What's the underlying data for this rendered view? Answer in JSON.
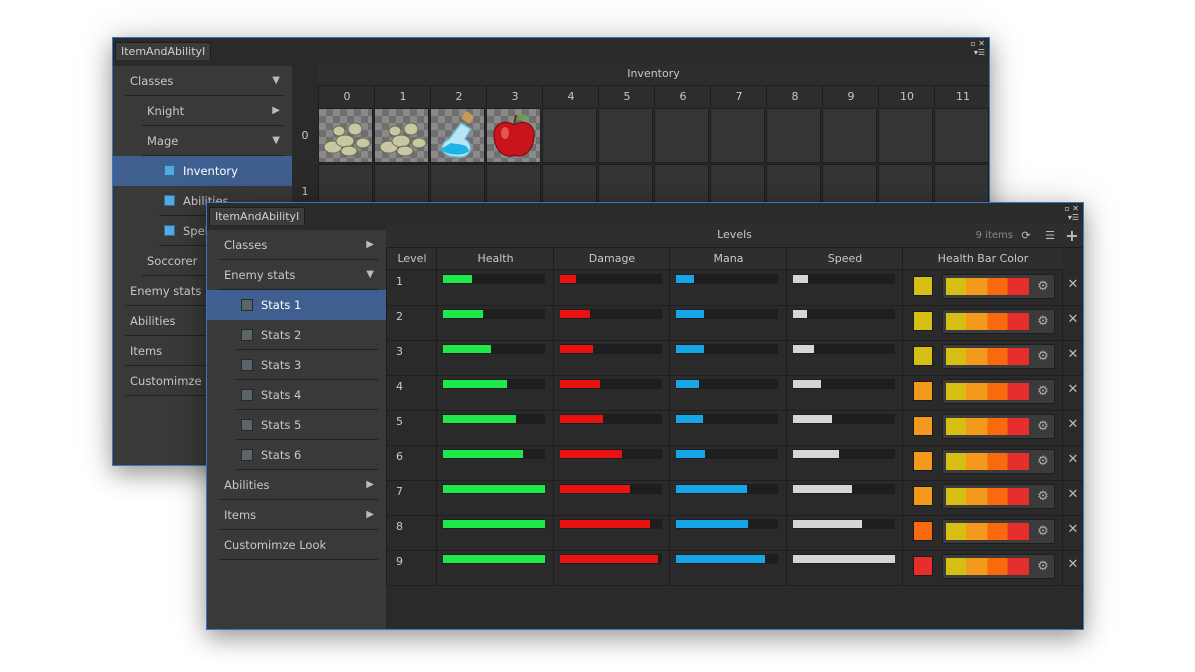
{
  "back_window": {
    "tab": "ItemAndAbilityI",
    "sidebar": [
      {
        "label": "Classes",
        "indent": 0,
        "arrow": "▼",
        "icon": "",
        "selected": false
      },
      {
        "label": "Knight",
        "indent": 1,
        "arrow": "▶",
        "icon": "",
        "selected": false
      },
      {
        "label": "Mage",
        "indent": 1,
        "arrow": "▼",
        "icon": "",
        "selected": false
      },
      {
        "label": "Inventory",
        "indent": 2,
        "arrow": "",
        "icon": "cube-icon",
        "selected": true
      },
      {
        "label": "Abilities",
        "indent": 2,
        "arrow": "",
        "icon": "cube-icon",
        "selected": false
      },
      {
        "label": "Spells",
        "indent": 2,
        "arrow": "",
        "icon": "cube-icon",
        "selected": false
      },
      {
        "label": "Soccorer",
        "indent": 1,
        "arrow": "",
        "icon": "",
        "selected": false
      },
      {
        "label": "Enemy stats",
        "indent": 0,
        "arrow": "",
        "icon": "",
        "selected": false
      },
      {
        "label": "Abilities",
        "indent": 0,
        "arrow": "",
        "icon": "",
        "selected": false
      },
      {
        "label": "Items",
        "indent": 0,
        "arrow": "",
        "icon": "",
        "selected": false
      },
      {
        "label": "Customimze",
        "indent": 0,
        "arrow": "",
        "icon": "",
        "selected": false
      }
    ],
    "inventory": {
      "title": "Inventory",
      "columns": [
        "0",
        "1",
        "2",
        "3",
        "4",
        "5",
        "6",
        "7",
        "8",
        "9",
        "10",
        "11"
      ],
      "rows": [
        "0",
        "1"
      ],
      "items": [
        {
          "col": 0,
          "icon": "coins-icon"
        },
        {
          "col": 1,
          "icon": "coins-icon"
        },
        {
          "col": 2,
          "icon": "potion-icon"
        },
        {
          "col": 3,
          "icon": "apple-icon"
        }
      ]
    }
  },
  "front_window": {
    "tab": "ItemAndAbilityI",
    "sidebar": [
      {
        "label": "Classes",
        "indent": 0,
        "arrow": "▶",
        "icon": "",
        "selected": false
      },
      {
        "label": "Enemy stats",
        "indent": 0,
        "arrow": "▼",
        "icon": "",
        "selected": false
      },
      {
        "label": "Stats 1",
        "indent": 1,
        "arrow": "",
        "icon": "asset-icon",
        "selected": true
      },
      {
        "label": "Stats 2",
        "indent": 1,
        "arrow": "",
        "icon": "asset-icon",
        "selected": false
      },
      {
        "label": "Stats 3",
        "indent": 1,
        "arrow": "",
        "icon": "asset-icon",
        "selected": false
      },
      {
        "label": "Stats 4",
        "indent": 1,
        "arrow": "",
        "icon": "asset-icon",
        "selected": false
      },
      {
        "label": "Stats 5",
        "indent": 1,
        "arrow": "",
        "icon": "asset-icon",
        "selected": false
      },
      {
        "label": "Stats 6",
        "indent": 1,
        "arrow": "",
        "icon": "asset-icon",
        "selected": false
      },
      {
        "label": "Abilities",
        "indent": 0,
        "arrow": "▶",
        "icon": "",
        "selected": false
      },
      {
        "label": "Items",
        "indent": 0,
        "arrow": "▶",
        "icon": "",
        "selected": false
      },
      {
        "label": "Customimze Look",
        "indent": 0,
        "arrow": "",
        "icon": "",
        "selected": false
      }
    ],
    "levels": {
      "title": "Levels",
      "count": "9 items",
      "headers": [
        "Level",
        "Health",
        "Damage",
        "Mana",
        "Speed",
        "Health Bar Color"
      ],
      "colors": {
        "health": "#1ee84a",
        "damage": "#e8130f",
        "mana": "#16a6e8",
        "speed": "#d6d6d6"
      },
      "rows": [
        {
          "level": "1",
          "health": 0.28,
          "damage": 0.16,
          "mana": 0.18,
          "speed": 0.15,
          "swatch": "#d7be12"
        },
        {
          "level": "2",
          "health": 0.39,
          "damage": 0.29,
          "mana": 0.27,
          "speed": 0.14,
          "swatch": "#d7be12"
        },
        {
          "level": "3",
          "health": 0.47,
          "damage": 0.32,
          "mana": 0.27,
          "speed": 0.21,
          "swatch": "#d7be12"
        },
        {
          "level": "4",
          "health": 0.63,
          "damage": 0.39,
          "mana": 0.23,
          "speed": 0.27,
          "swatch": "#f39a1d"
        },
        {
          "level": "5",
          "health": 0.72,
          "damage": 0.42,
          "mana": 0.26,
          "speed": 0.38,
          "swatch": "#f39a1d"
        },
        {
          "level": "6",
          "health": 0.78,
          "damage": 0.61,
          "mana": 0.28,
          "speed": 0.45,
          "swatch": "#f39a1d"
        },
        {
          "level": "7",
          "health": 1.0,
          "damage": 0.69,
          "mana": 0.7,
          "speed": 0.58,
          "swatch": "#f39a1d"
        },
        {
          "level": "8",
          "health": 1.0,
          "damage": 0.88,
          "mana": 0.71,
          "speed": 0.68,
          "swatch": "#f96a0e"
        },
        {
          "level": "9",
          "health": 1.0,
          "damage": 0.96,
          "mana": 0.87,
          "speed": 1.0,
          "swatch": "#e62e2d"
        }
      ]
    }
  }
}
